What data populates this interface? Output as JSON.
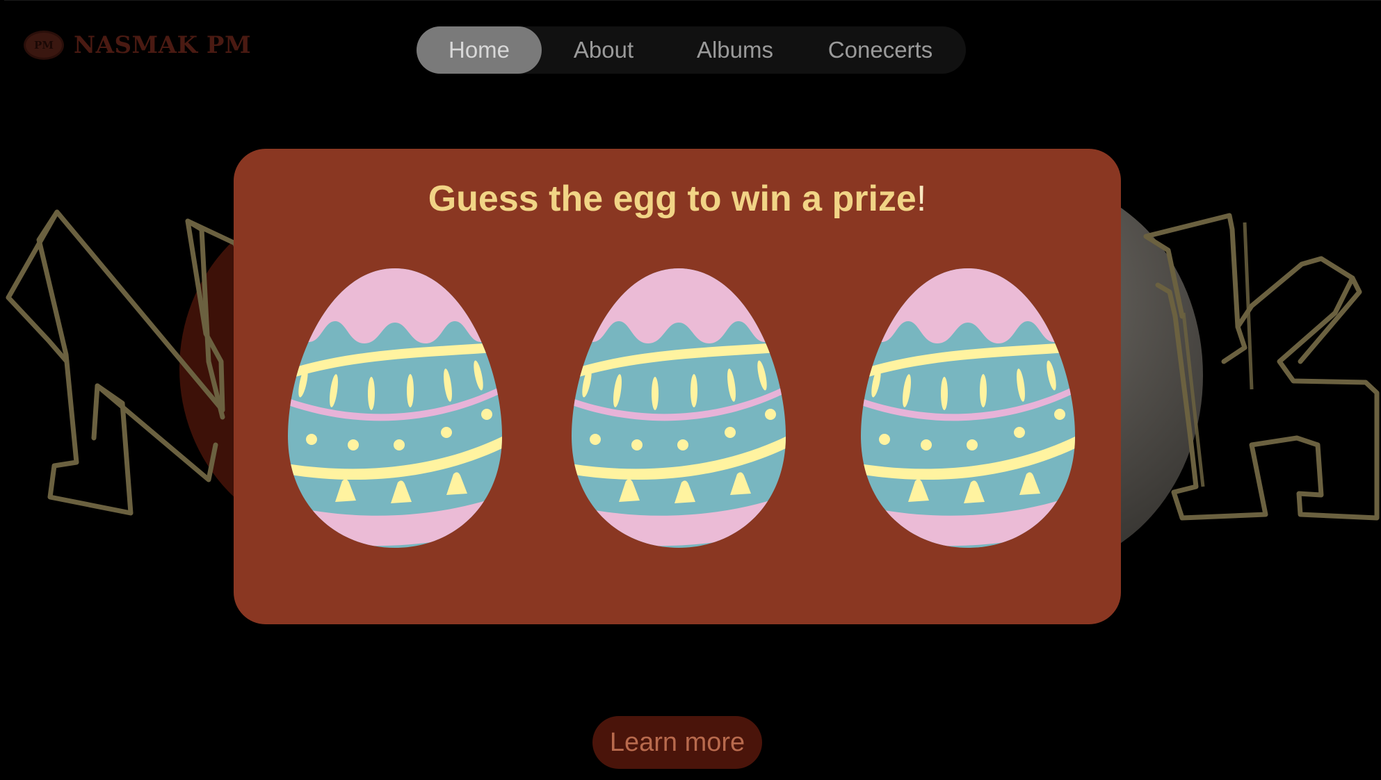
{
  "logo": {
    "badge": "PM",
    "name": "NASMAK PM"
  },
  "nav": {
    "items": [
      {
        "label": "Home",
        "active": true
      },
      {
        "label": "About"
      },
      {
        "label": "Albums"
      },
      {
        "label": "Conecerts"
      }
    ]
  },
  "modal": {
    "title": "Guess the egg to win a prize",
    "title_end": "!",
    "eggs": [
      "egg",
      "egg",
      "egg"
    ]
  },
  "cta": {
    "label": "Learn more"
  },
  "colors": {
    "modal_bg": "#8a3722",
    "title": "#f1d486",
    "egg_pink": "#ebbbd6",
    "egg_teal": "#78b6c0",
    "egg_yellow": "#fff3a0",
    "graffiti": "#6b6140"
  }
}
